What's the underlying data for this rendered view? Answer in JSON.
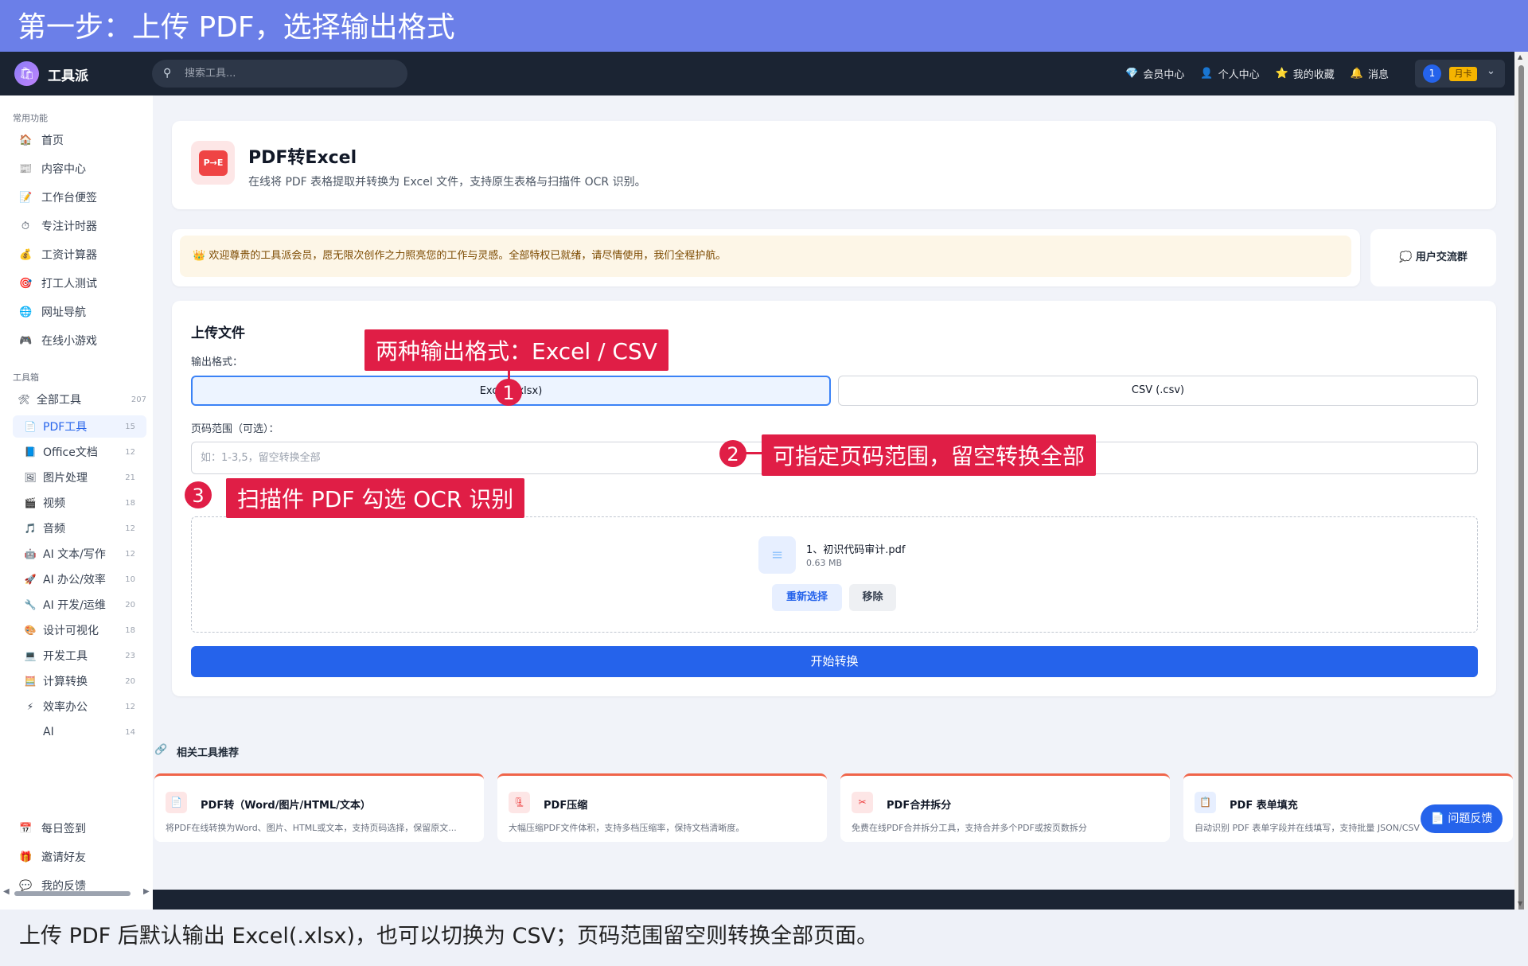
{
  "tutorial": {
    "step_title": "第一步：上传 PDF，选择输出格式",
    "caption": "上传 PDF 后默认输出 Excel(.xlsx)，也可以切换为 CSV；页码范围留空则转换全部页面。",
    "callouts": [
      {
        "num": "1",
        "text": "两种输出格式：Excel / CSV"
      },
      {
        "num": "2",
        "text": "可指定页码范围，留空转换全部"
      },
      {
        "num": "3",
        "text": "扫描件 PDF 勾选 OCR 识别"
      }
    ]
  },
  "topnav": {
    "logo_text": "工具派",
    "search_placeholder": "搜索工具...",
    "links": [
      {
        "icon": "diamond-icon",
        "glyph": "💎",
        "label": "会员中心"
      },
      {
        "icon": "user-icon",
        "glyph": "👤",
        "label": "个人中心"
      },
      {
        "icon": "star-icon",
        "glyph": "⭐",
        "label": "我的收藏"
      },
      {
        "icon": "bell-icon",
        "glyph": "🔔",
        "label": "消息"
      }
    ],
    "user_avatar": "1",
    "user_badge": "月卡"
  },
  "sidebar": {
    "common_title": "常用功能",
    "common": [
      {
        "icon": "home-icon",
        "glyph": "🏠",
        "label": "首页"
      },
      {
        "icon": "content-icon",
        "glyph": "📰",
        "label": "内容中心"
      },
      {
        "icon": "note-icon",
        "glyph": "📝",
        "label": "工作台便签"
      },
      {
        "icon": "timer-icon",
        "glyph": "⏱",
        "label": "专注计时器"
      },
      {
        "icon": "money-icon",
        "glyph": "💰",
        "label": "工资计算器"
      },
      {
        "icon": "target-icon",
        "glyph": "🎯",
        "label": "打工人测试"
      },
      {
        "icon": "globe-icon",
        "glyph": "🌐",
        "label": "网址导航"
      },
      {
        "icon": "gamepad-icon",
        "glyph": "🎮",
        "label": "在线小游戏"
      }
    ],
    "toolbox_title": "工具箱",
    "all_tools": {
      "glyph": "🛠",
      "label": "全部工具",
      "count": "207"
    },
    "tools": [
      {
        "icon": "pdf-icon",
        "glyph": "📄",
        "label": "PDF工具",
        "count": "15",
        "active": true
      },
      {
        "icon": "office-icon",
        "glyph": "📘",
        "label": "Office文档",
        "count": "12"
      },
      {
        "icon": "image-icon",
        "glyph": "🖼",
        "label": "图片处理",
        "count": "21"
      },
      {
        "icon": "video-icon",
        "glyph": "🎬",
        "label": "视频",
        "count": "18"
      },
      {
        "icon": "music-icon",
        "glyph": "🎵",
        "label": "音频",
        "count": "12"
      },
      {
        "icon": "robot-icon",
        "glyph": "🤖",
        "label": "AI 文本/写作",
        "count": "12"
      },
      {
        "icon": "rocket-icon",
        "glyph": "🚀",
        "label": "AI 办公/效率",
        "count": "10"
      },
      {
        "icon": "wrench-icon",
        "glyph": "🔧",
        "label": "AI 开发/运维",
        "count": "20"
      },
      {
        "icon": "palette-icon",
        "glyph": "🎨",
        "label": "设计可视化",
        "count": "18"
      },
      {
        "icon": "computer-icon",
        "glyph": "💻",
        "label": "开发工具",
        "count": "23"
      },
      {
        "icon": "calculator-icon",
        "glyph": "🧮",
        "label": "计算转换",
        "count": "20"
      },
      {
        "icon": "lightning-icon",
        "glyph": "⚡",
        "label": "效率办公",
        "count": "12"
      },
      {
        "icon": "",
        "glyph": "",
        "label": "AI",
        "count": "14"
      }
    ],
    "bottom": [
      {
        "icon": "calendar-icon",
        "glyph": "📅",
        "label": "每日签到"
      },
      {
        "icon": "gift-icon",
        "glyph": "🎁",
        "label": "邀请好友"
      },
      {
        "icon": "chat-icon",
        "glyph": "💬",
        "label": "我的反馈"
      }
    ]
  },
  "header": {
    "icon_text": "P→E",
    "title": "PDF转Excel",
    "description": "在线将 PDF 表格提取并转换为 Excel 文件，支持原生表格与扫描件 OCR 识别。"
  },
  "welcome": {
    "text": "👑 欢迎尊贵的工具派会员，愿无限次创作之力照亮您的工作与灵感。全部特权已就绪，请尽情使用，我们全程护航。",
    "group_label": "💭 用户交流群"
  },
  "upload": {
    "title": "上传文件",
    "format_label": "输出格式：",
    "format_options": [
      "Excel (.xlsx)",
      "CSV (.csv)"
    ],
    "selected_format": "Excel (.xlsx)",
    "page_label": "页码范围（可选）：",
    "page_placeholder": "如：1-3,5，留空转换全部",
    "file_name": "1、初识代码审计.pdf",
    "file_size": "0.63 MB",
    "reselect_label": "重新选择",
    "remove_label": "移除",
    "start_label": "开始转换"
  },
  "related": {
    "title": "相关工具推荐",
    "items": [
      {
        "glyph": "📄",
        "name": "PDF转（Word/图片/HTML/文本）",
        "desc": "将PDF在线转换为Word、图片、HTML或文本，支持页码选择，保留原文..."
      },
      {
        "glyph": "🗜",
        "name": "PDF压缩",
        "desc": "大幅压缩PDF文件体积，支持多档压缩率，保持文档清晰度。"
      },
      {
        "glyph": "✂",
        "name": "PDF合并拆分",
        "desc": "免费在线PDF合并拆分工具，支持合并多个PDF或按页数拆分"
      },
      {
        "glyph": "📋",
        "name": "PDF 表单填充",
        "desc": "自动识别 PDF 表单字段并在线填写，支持批量 JSON/CSV"
      }
    ]
  },
  "feedback_label": "📄 问题反馈"
}
